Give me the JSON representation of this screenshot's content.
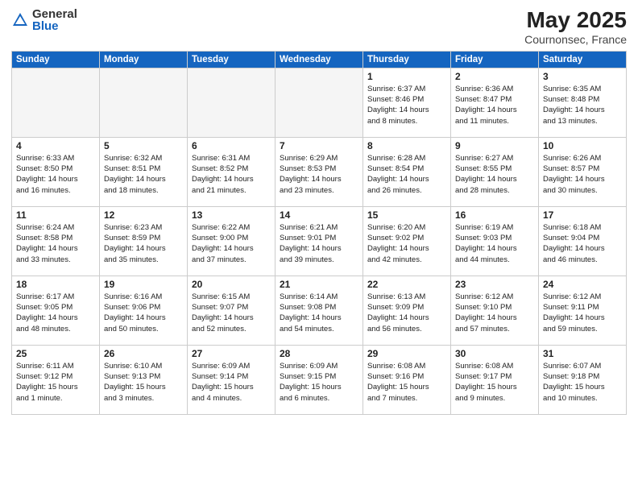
{
  "header": {
    "logo_general": "General",
    "logo_blue": "Blue",
    "title": "May 2025",
    "subtitle": "Cournonsec, France"
  },
  "weekdays": [
    "Sunday",
    "Monday",
    "Tuesday",
    "Wednesday",
    "Thursday",
    "Friday",
    "Saturday"
  ],
  "weeks": [
    [
      {
        "day": "",
        "info": ""
      },
      {
        "day": "",
        "info": ""
      },
      {
        "day": "",
        "info": ""
      },
      {
        "day": "",
        "info": ""
      },
      {
        "day": "1",
        "info": "Sunrise: 6:37 AM\nSunset: 8:46 PM\nDaylight: 14 hours\nand 8 minutes."
      },
      {
        "day": "2",
        "info": "Sunrise: 6:36 AM\nSunset: 8:47 PM\nDaylight: 14 hours\nand 11 minutes."
      },
      {
        "day": "3",
        "info": "Sunrise: 6:35 AM\nSunset: 8:48 PM\nDaylight: 14 hours\nand 13 minutes."
      }
    ],
    [
      {
        "day": "4",
        "info": "Sunrise: 6:33 AM\nSunset: 8:50 PM\nDaylight: 14 hours\nand 16 minutes."
      },
      {
        "day": "5",
        "info": "Sunrise: 6:32 AM\nSunset: 8:51 PM\nDaylight: 14 hours\nand 18 minutes."
      },
      {
        "day": "6",
        "info": "Sunrise: 6:31 AM\nSunset: 8:52 PM\nDaylight: 14 hours\nand 21 minutes."
      },
      {
        "day": "7",
        "info": "Sunrise: 6:29 AM\nSunset: 8:53 PM\nDaylight: 14 hours\nand 23 minutes."
      },
      {
        "day": "8",
        "info": "Sunrise: 6:28 AM\nSunset: 8:54 PM\nDaylight: 14 hours\nand 26 minutes."
      },
      {
        "day": "9",
        "info": "Sunrise: 6:27 AM\nSunset: 8:55 PM\nDaylight: 14 hours\nand 28 minutes."
      },
      {
        "day": "10",
        "info": "Sunrise: 6:26 AM\nSunset: 8:57 PM\nDaylight: 14 hours\nand 30 minutes."
      }
    ],
    [
      {
        "day": "11",
        "info": "Sunrise: 6:24 AM\nSunset: 8:58 PM\nDaylight: 14 hours\nand 33 minutes."
      },
      {
        "day": "12",
        "info": "Sunrise: 6:23 AM\nSunset: 8:59 PM\nDaylight: 14 hours\nand 35 minutes."
      },
      {
        "day": "13",
        "info": "Sunrise: 6:22 AM\nSunset: 9:00 PM\nDaylight: 14 hours\nand 37 minutes."
      },
      {
        "day": "14",
        "info": "Sunrise: 6:21 AM\nSunset: 9:01 PM\nDaylight: 14 hours\nand 39 minutes."
      },
      {
        "day": "15",
        "info": "Sunrise: 6:20 AM\nSunset: 9:02 PM\nDaylight: 14 hours\nand 42 minutes."
      },
      {
        "day": "16",
        "info": "Sunrise: 6:19 AM\nSunset: 9:03 PM\nDaylight: 14 hours\nand 44 minutes."
      },
      {
        "day": "17",
        "info": "Sunrise: 6:18 AM\nSunset: 9:04 PM\nDaylight: 14 hours\nand 46 minutes."
      }
    ],
    [
      {
        "day": "18",
        "info": "Sunrise: 6:17 AM\nSunset: 9:05 PM\nDaylight: 14 hours\nand 48 minutes."
      },
      {
        "day": "19",
        "info": "Sunrise: 6:16 AM\nSunset: 9:06 PM\nDaylight: 14 hours\nand 50 minutes."
      },
      {
        "day": "20",
        "info": "Sunrise: 6:15 AM\nSunset: 9:07 PM\nDaylight: 14 hours\nand 52 minutes."
      },
      {
        "day": "21",
        "info": "Sunrise: 6:14 AM\nSunset: 9:08 PM\nDaylight: 14 hours\nand 54 minutes."
      },
      {
        "day": "22",
        "info": "Sunrise: 6:13 AM\nSunset: 9:09 PM\nDaylight: 14 hours\nand 56 minutes."
      },
      {
        "day": "23",
        "info": "Sunrise: 6:12 AM\nSunset: 9:10 PM\nDaylight: 14 hours\nand 57 minutes."
      },
      {
        "day": "24",
        "info": "Sunrise: 6:12 AM\nSunset: 9:11 PM\nDaylight: 14 hours\nand 59 minutes."
      }
    ],
    [
      {
        "day": "25",
        "info": "Sunrise: 6:11 AM\nSunset: 9:12 PM\nDaylight: 15 hours\nand 1 minute."
      },
      {
        "day": "26",
        "info": "Sunrise: 6:10 AM\nSunset: 9:13 PM\nDaylight: 15 hours\nand 3 minutes."
      },
      {
        "day": "27",
        "info": "Sunrise: 6:09 AM\nSunset: 9:14 PM\nDaylight: 15 hours\nand 4 minutes."
      },
      {
        "day": "28",
        "info": "Sunrise: 6:09 AM\nSunset: 9:15 PM\nDaylight: 15 hours\nand 6 minutes."
      },
      {
        "day": "29",
        "info": "Sunrise: 6:08 AM\nSunset: 9:16 PM\nDaylight: 15 hours\nand 7 minutes."
      },
      {
        "day": "30",
        "info": "Sunrise: 6:08 AM\nSunset: 9:17 PM\nDaylight: 15 hours\nand 9 minutes."
      },
      {
        "day": "31",
        "info": "Sunrise: 6:07 AM\nSunset: 9:18 PM\nDaylight: 15 hours\nand 10 minutes."
      }
    ]
  ]
}
